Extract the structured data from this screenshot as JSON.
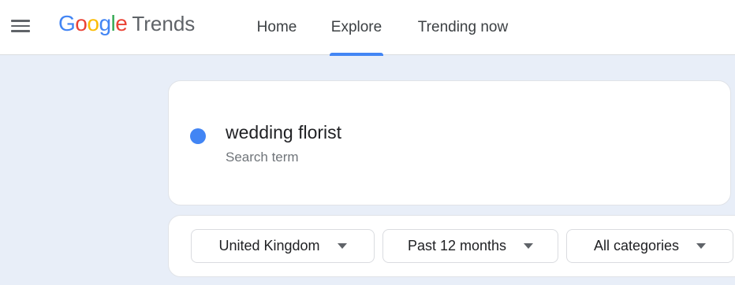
{
  "header": {
    "logo": {
      "google_letters": [
        {
          "char": "G",
          "color": "#4285F4"
        },
        {
          "char": "o",
          "color": "#EA4335"
        },
        {
          "char": "o",
          "color": "#FBBC05"
        },
        {
          "char": "g",
          "color": "#4285F4"
        },
        {
          "char": "l",
          "color": "#34A853"
        },
        {
          "char": "e",
          "color": "#EA4335"
        }
      ],
      "product": "Trends"
    },
    "menu_icon": "hamburger-menu-icon",
    "tabs": [
      {
        "label": "Home",
        "active": false
      },
      {
        "label": "Explore",
        "active": true
      },
      {
        "label": "Trending now",
        "active": false
      }
    ]
  },
  "search": {
    "term": "wedding florist",
    "type_label": "Search term",
    "term_color": "#4285F4"
  },
  "filters": {
    "location": "United Kingdom",
    "time_range": "Past 12 months",
    "category": "All categories"
  },
  "colors": {
    "accent": "#4285F4",
    "page_background": "#E8EEF8"
  }
}
